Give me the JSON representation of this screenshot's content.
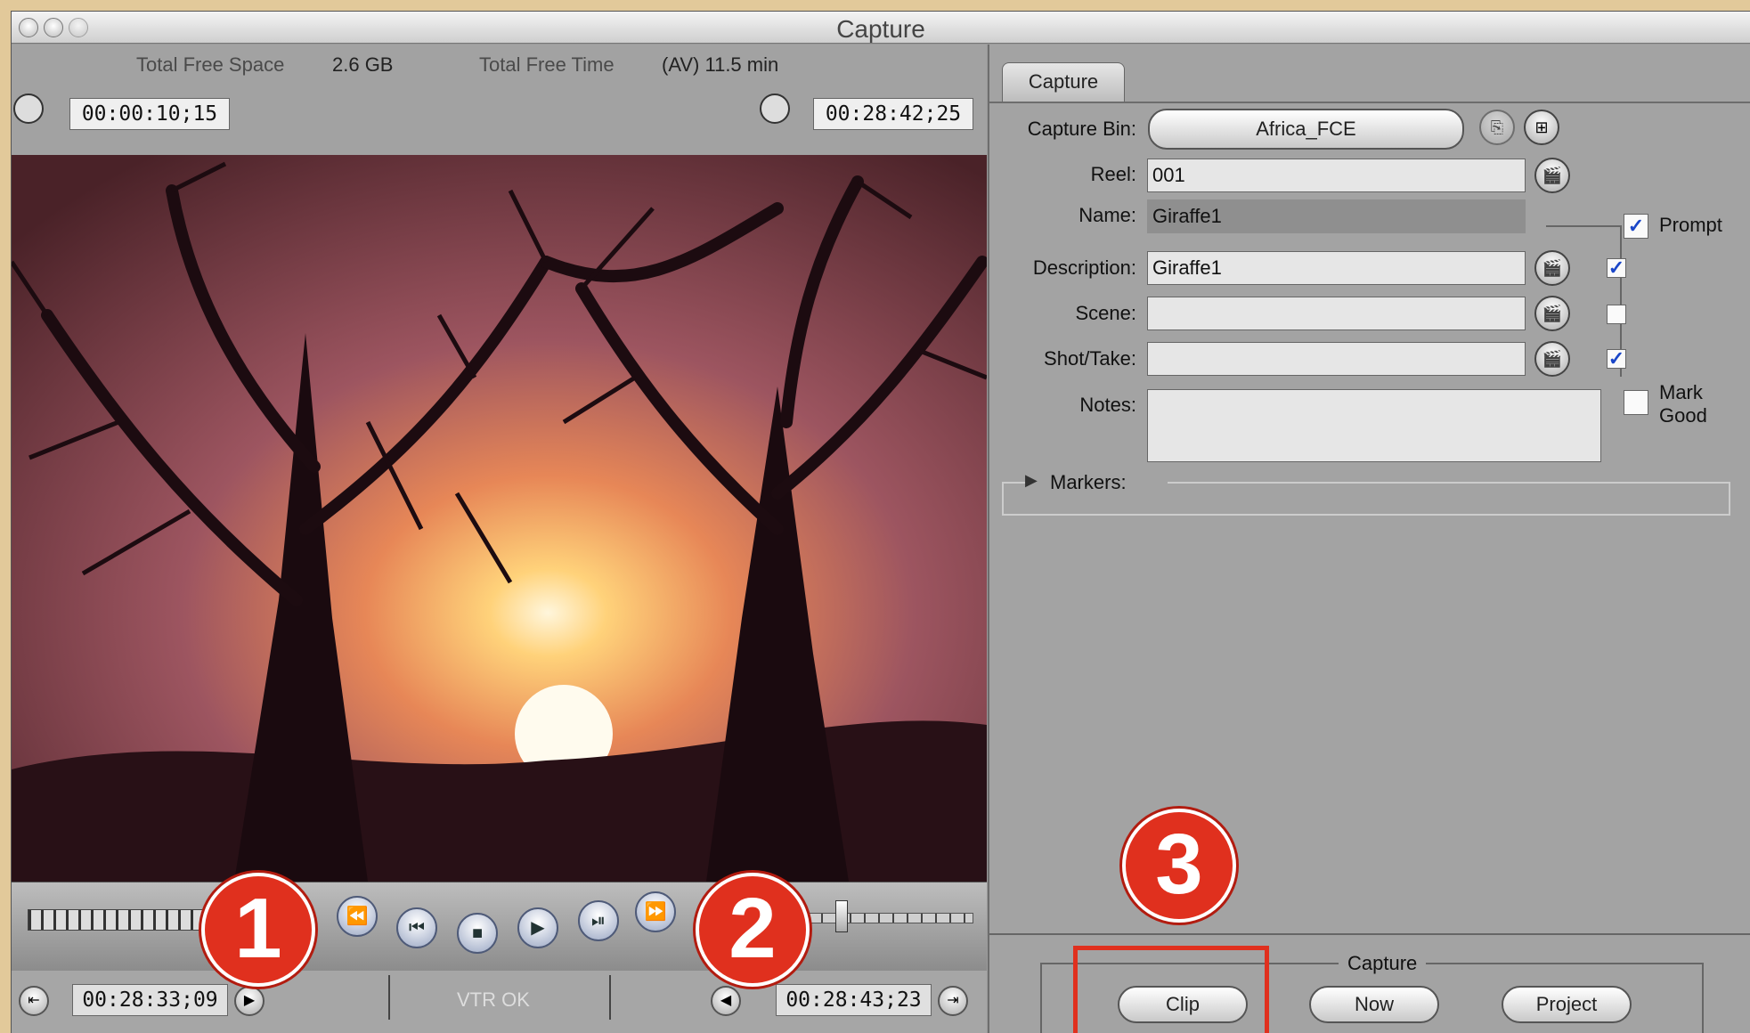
{
  "window": {
    "title": "Capture"
  },
  "info": {
    "free_space_label": "Total Free Space",
    "free_space_value": "2.6 GB",
    "free_time_label": "Total Free Time",
    "free_time_value": "(AV) 11.5 min"
  },
  "timecodes": {
    "duration": "00:00:10;15",
    "current": "00:28:42;25",
    "in_point": "00:28:33;09",
    "out_point": "00:28:43;23"
  },
  "status": {
    "vtr": "VTR OK"
  },
  "callouts": [
    "1",
    "2",
    "3"
  ],
  "panel": {
    "tab_label": "Capture",
    "capture_bin_label": "Capture Bin:",
    "capture_bin_value": "Africa_FCE",
    "reel_label": "Reel:",
    "reel_value": "001",
    "name_label": "Name:",
    "name_value": "Giraffe1",
    "prompt_label": "Prompt",
    "description_label": "Description:",
    "description_value": "Giraffe1",
    "scene_label": "Scene:",
    "scene_value": "",
    "shot_label": "Shot/Take:",
    "shot_value": "",
    "notes_label": "Notes:",
    "notes_value": "",
    "mark_good_line1": "Mark",
    "mark_good_line2": "Good",
    "markers_label": "Markers:"
  },
  "capture_group": {
    "title": "Capture",
    "clip": "Clip",
    "now": "Now",
    "project": "Project"
  },
  "colors": {
    "callout": "#e0301e",
    "highlight_box": "#e0301e",
    "checkbox_blue": "#1a46c8"
  },
  "icons": [
    "close-icon",
    "minimize-icon",
    "zoom-icon",
    "duration-clock-icon",
    "current-timecode-clock-icon",
    "clapper-icon",
    "new-bin-icon",
    "rewind-icon",
    "play-in-to-out-icon",
    "stop-icon",
    "play-icon",
    "play-around-icon",
    "fast-forward-icon",
    "set-in-icon",
    "go-to-in-icon",
    "go-to-out-icon",
    "set-out-icon",
    "disclosure-triangle-icon"
  ]
}
